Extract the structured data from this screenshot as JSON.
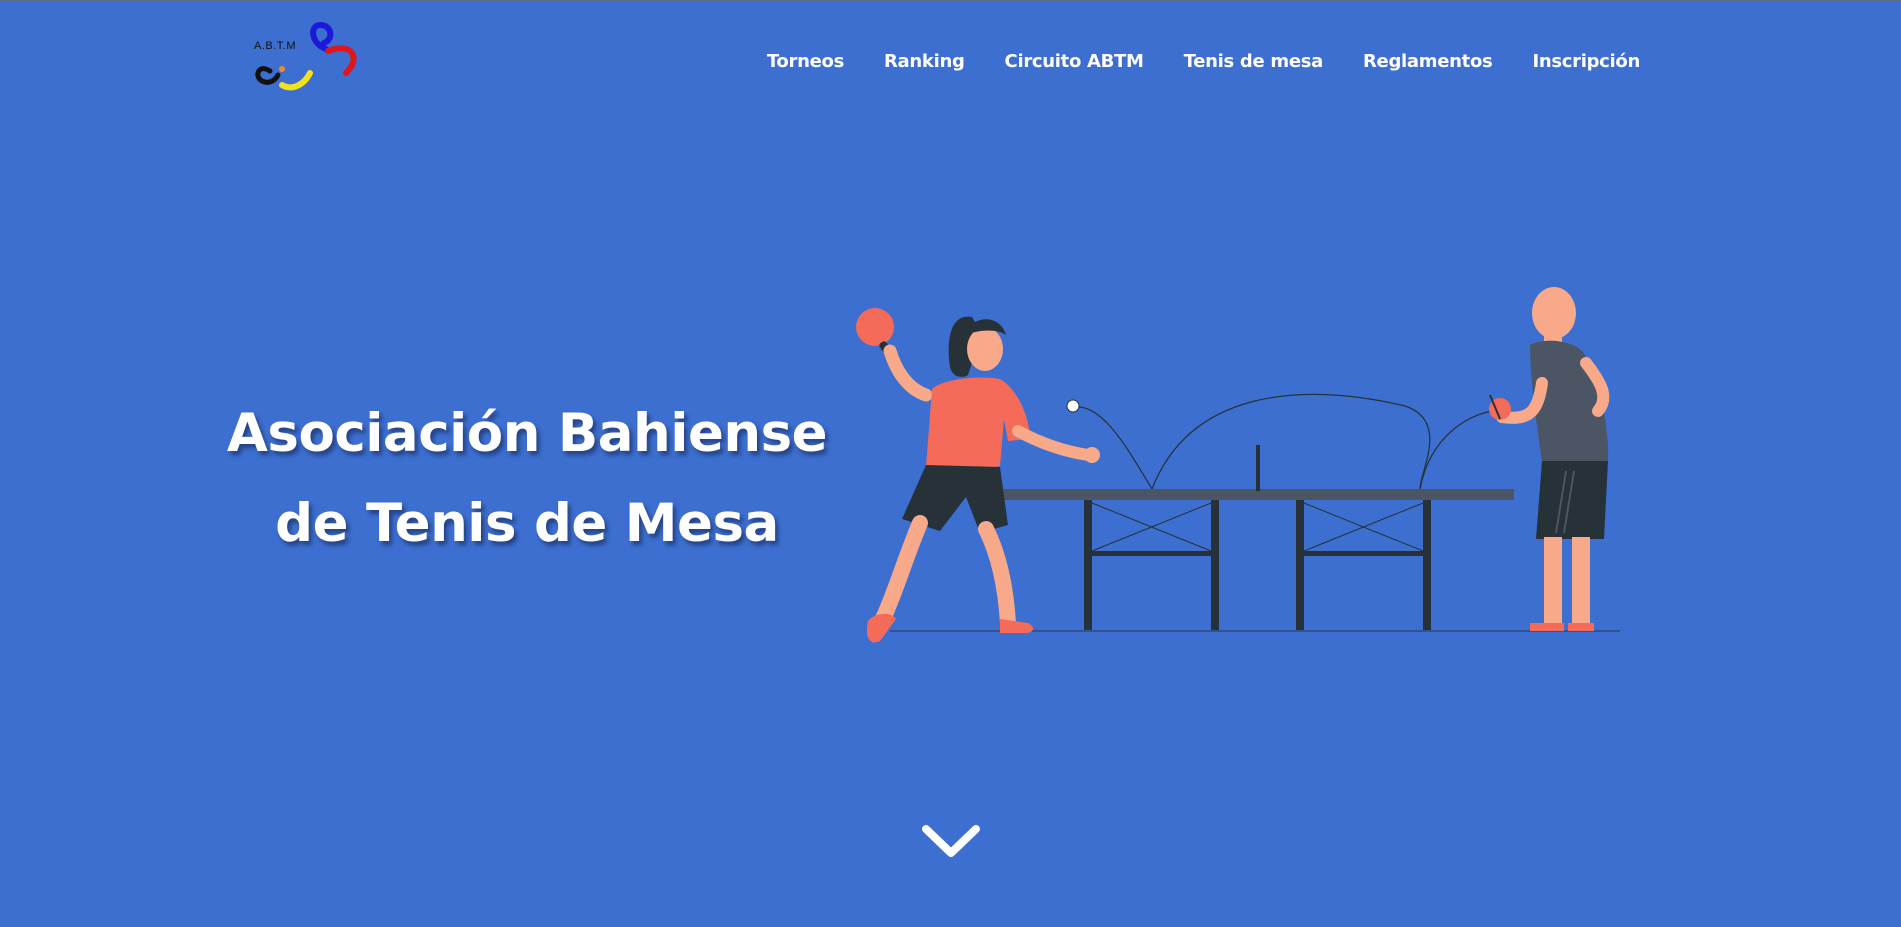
{
  "brand": {
    "logo_text": "A.B.T.M"
  },
  "nav": {
    "items": [
      {
        "label": "Torneos"
      },
      {
        "label": "Ranking"
      },
      {
        "label": "Circuito ABTM"
      },
      {
        "label": "Tenis de mesa"
      },
      {
        "label": "Reglamentos"
      },
      {
        "label": "Inscripción"
      }
    ]
  },
  "hero": {
    "title_line1": "Asociación Bahiense",
    "title_line2": "de Tenis de Mesa"
  },
  "icons": {
    "scroll": "chevron-down-icon"
  },
  "colors": {
    "background": "#3c6fd0",
    "text": "#ffffff",
    "shirt_woman": "#f46b5a",
    "table": "#4b5563",
    "dark": "#263238",
    "skin": "#f7a98a"
  }
}
